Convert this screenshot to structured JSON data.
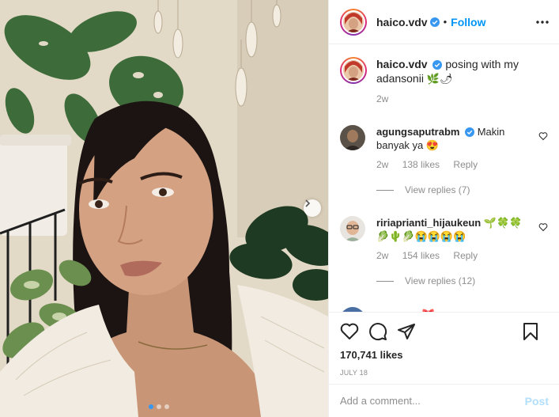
{
  "post": {
    "author": "haico.vdv",
    "follow_label": "Follow",
    "separator": "•",
    "caption_text": "posing with my adansonii",
    "caption_emoji": "🌿🌶",
    "caption_time": "2w",
    "likes": "170,741 likes",
    "date": "JULY 18",
    "carousel_dots": 3,
    "active_dot": 0
  },
  "comments": [
    {
      "user": "agungsaputrabm",
      "verified": true,
      "text": "Makin banyak ya",
      "emoji": "😍",
      "time": "2w",
      "likes": "138 likes",
      "reply_label": "Reply",
      "view_replies": "View replies (7)"
    },
    {
      "user": "ririaprianti_hijaukeun",
      "verified": false,
      "text": "",
      "emoji": "🌱🍀🍀🥬🌵🥬😭😭😭😭",
      "time": "2w",
      "likes": "154 likes",
      "reply_label": "Reply",
      "view_replies": "View replies (12)"
    },
    {
      "user": "romeuax",
      "verified": false,
      "text": "",
      "emoji": "🎀",
      "time": "",
      "likes": "",
      "reply_label": "",
      "view_replies": ""
    }
  ],
  "composer": {
    "placeholder": "Add a comment...",
    "post_label": "Post"
  },
  "icons": {
    "next": "chevron-right-icon",
    "more": "more-horizontal-icon",
    "like": "heart-icon",
    "comment": "comment-icon",
    "share": "share-icon",
    "save": "bookmark-icon"
  },
  "colors": {
    "accent": "#0095f6",
    "verified": "#3897f0",
    "muted": "#8e8e8e",
    "text": "#262626",
    "post_disabled": "#b2dffc"
  }
}
